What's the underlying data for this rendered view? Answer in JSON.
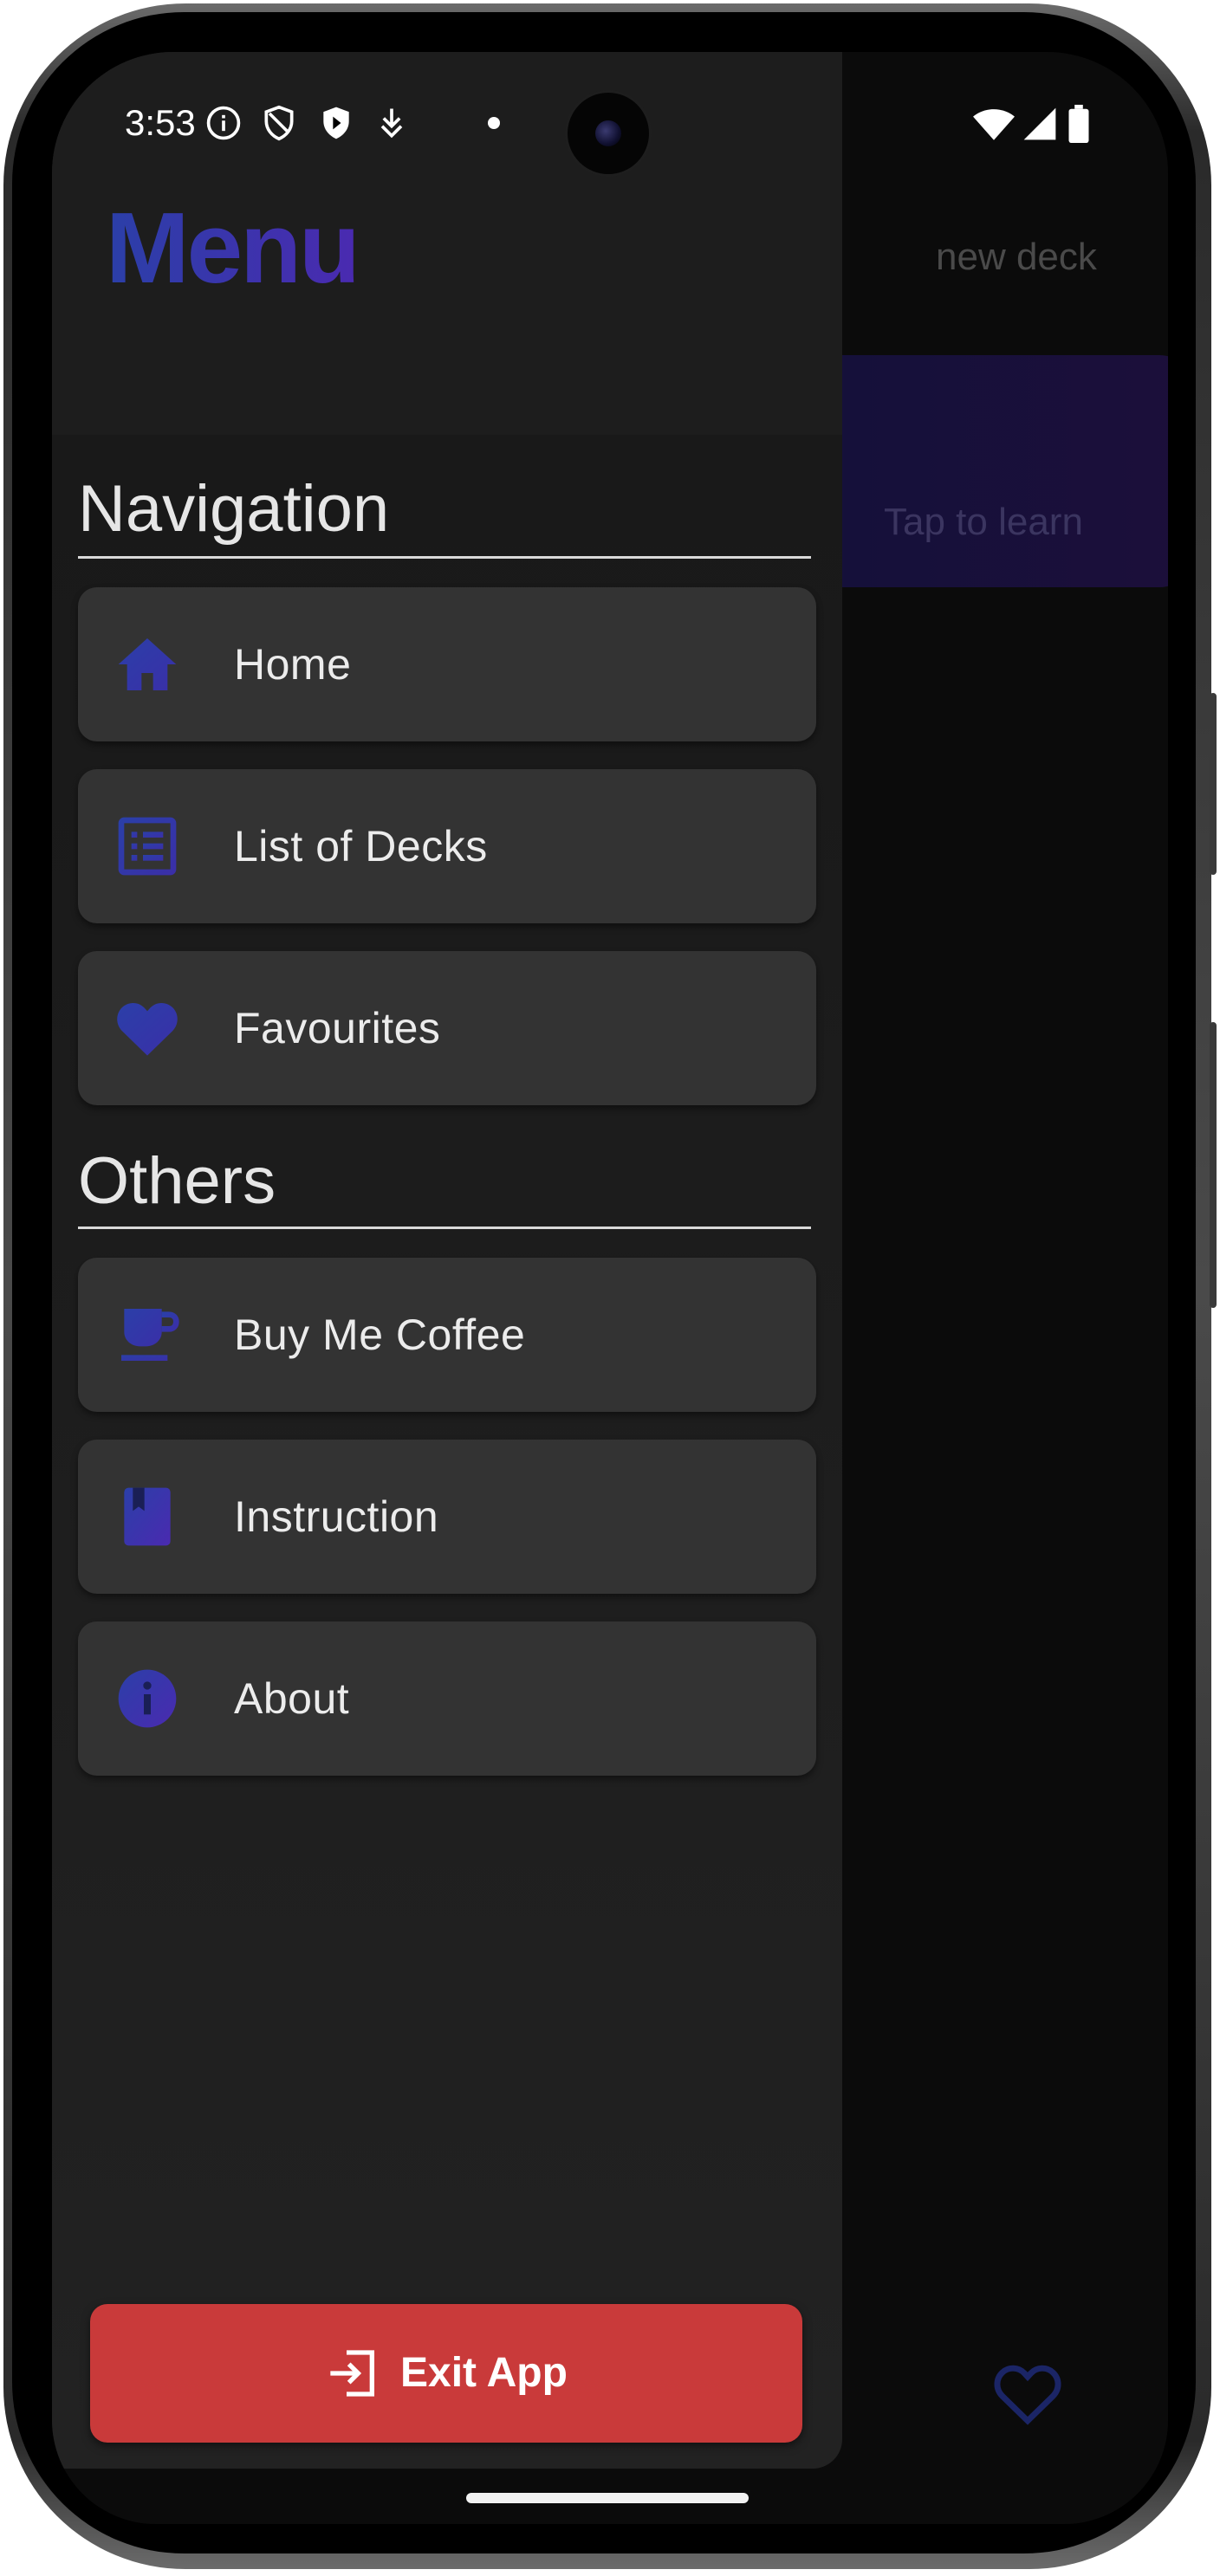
{
  "status_bar": {
    "time": "3:53",
    "left_icons": [
      "info-icon",
      "shield-outline-icon",
      "shield-filled-icon",
      "download-arrow-icon",
      "dot-icon"
    ],
    "right_icons": [
      "wifi-icon",
      "cellular-signal-icon",
      "battery-icon"
    ]
  },
  "background_app": {
    "header_action": "new deck",
    "card_text": "Tap to learn",
    "bottom_icon": "heart-outline-icon"
  },
  "drawer": {
    "title": "Menu",
    "sections": [
      {
        "title": "Navigation",
        "items": [
          {
            "label": "Home",
            "icon": "home-icon"
          },
          {
            "label": "List of Decks",
            "icon": "list-icon"
          },
          {
            "label": "Favourites",
            "icon": "heart-icon"
          }
        ]
      },
      {
        "title": "Others",
        "items": [
          {
            "label": "Buy Me Coffee",
            "icon": "coffee-cup-icon"
          },
          {
            "label": "Instruction",
            "icon": "book-icon"
          },
          {
            "label": "About",
            "icon": "info-icon"
          }
        ]
      }
    ],
    "exit_button": {
      "label": "Exit App",
      "icon": "exit-icon"
    }
  },
  "colors": {
    "accent_gradient_start": "#2b3fa8",
    "accent_gradient_end": "#4a2ab0",
    "item_background": "#333333",
    "exit_button": "#c93a3a",
    "drawer_background": "#1d1d1d"
  }
}
